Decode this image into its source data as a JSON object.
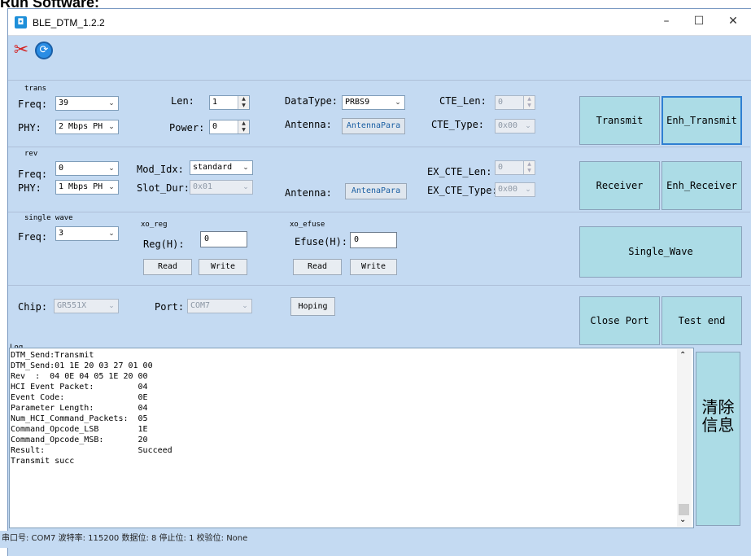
{
  "doc_heading": "Run Software:",
  "window": {
    "title": "BLE_DTM_1.2.2",
    "min": "–",
    "max": "☐",
    "close": "✕"
  },
  "toolbar": {
    "settings_glyph": "✂",
    "refresh_glyph": "⟳"
  },
  "trans": {
    "group": "trans",
    "freq_label": "Freq:",
    "freq_value": "39",
    "phy_label": "PHY:",
    "phy_value": "2 Mbps PH",
    "len_label": "Len:",
    "len_value": "1",
    "power_label": "Power:",
    "power_value": "0",
    "datatype_label": "DataType:",
    "datatype_value": "PRBS9",
    "antenna_label": "Antenna:",
    "antenna_button": "AntennaPara",
    "cte_len_label": "CTE_Len:",
    "cte_len_value": "0",
    "cte_type_label": "CTE_Type:",
    "cte_type_value": "0x00",
    "transmit": "Transmit",
    "enh_transmit": "Enh_Transmit"
  },
  "rev": {
    "group": "rev",
    "freq_label": "Freq:",
    "freq_value": "0",
    "phy_label": "PHY:",
    "phy_value": "1 Mbps PH",
    "mod_idx_label": "Mod_Idx:",
    "mod_idx_value": "standard",
    "slot_dur_label": "Slot_Dur:",
    "slot_dur_value": "0x01",
    "antenna_label": "Antenna:",
    "antenna_button": "AntenaPara",
    "ex_cte_len_label": "EX_CTE_Len:",
    "ex_cte_len_value": "0",
    "ex_cte_type_label": "EX_CTE_Type:",
    "ex_cte_type_value": "0x00",
    "receiver": "Receiver",
    "enh_receiver": "Enh_Receiver"
  },
  "single": {
    "group": "single wave",
    "freq_label": "Freq:",
    "freq_value": "3",
    "xo_reg_group": "xo_reg",
    "reg_label": "Reg(H):",
    "reg_value": "0",
    "xo_efuse_group": "xo_efuse",
    "efuse_label": "Efuse(H):",
    "efuse_value": "0",
    "read": "Read",
    "write": "Write",
    "single_wave": "Single_Wave"
  },
  "chip": {
    "chip_label": "Chip:",
    "chip_value": "GR551X",
    "port_label": "Port:",
    "port_value": "COM7",
    "hoping": "Hoping",
    "close_port": "Close Port",
    "test_end": "Test end"
  },
  "log": {
    "label": "Log",
    "text": "DTM_Send:Transmit\nDTM_Send:01 1E 20 03 27 01 00\nRev  :  04 0E 04 05 1E 20 00\nHCI Event Packet:         04\nEvent Code:               0E\nParameter Length:         04\nNum_HCI_Command_Packets:  05\nCommand_Opcode_LSB        1E\nCommand_Opcode_MSB:       20\nResult:                   Succeed\nTransmit succ",
    "clear": "清除信息",
    "scroll_up": "⌃",
    "scroll_down": "⌄"
  },
  "status": "串口号: COM7  波特率: 115200  数据位: 8  停止位: 1  校验位: None"
}
